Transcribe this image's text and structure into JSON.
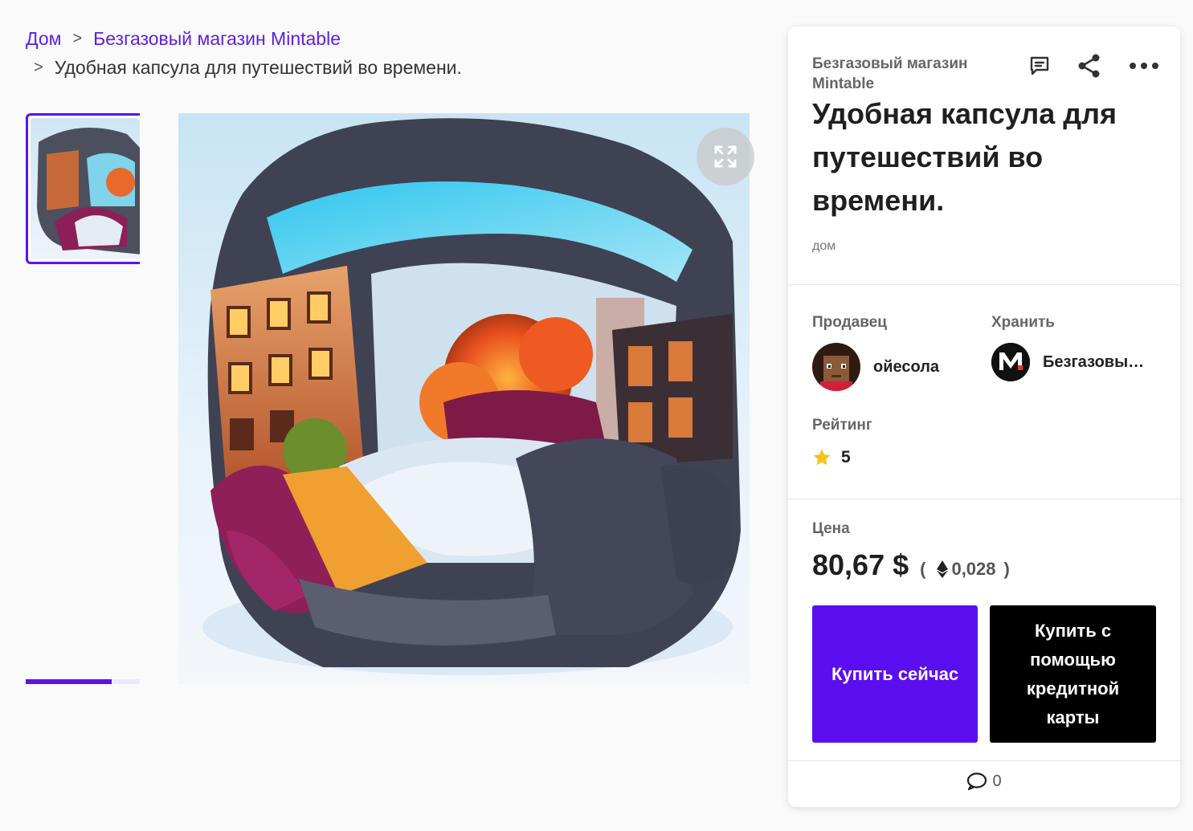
{
  "breadcrumb": {
    "home": "Дом",
    "collection": "Безгазовый магазин Mintable",
    "current": "Удобная капсула для путешествий во времени.",
    "separator": ">"
  },
  "gallery": {
    "progress": 0.75
  },
  "card": {
    "collection": "Безгазовый магазин Mintable",
    "title": "Удобная капсула для путешествий во времени.",
    "category": "дом",
    "seller_label": "Продавец",
    "seller_name": "ойесола",
    "store_label": "Хранить",
    "store_name": "Безгазовый магазин Mintable",
    "rating_label": "Рейтинг",
    "rating_value": "5",
    "price_label": "Цена",
    "price_usd": "80,67 $",
    "price_eth": "0,028",
    "paren_open": "(",
    "paren_close": ")",
    "buy_now": "Купить сейчас",
    "buy_card": "Купить с помощью кредитной карты",
    "comment_count": "0"
  },
  "colors": {
    "accent": "#5b0ef0",
    "link": "#5b21e6",
    "star": "#f7c21a"
  }
}
